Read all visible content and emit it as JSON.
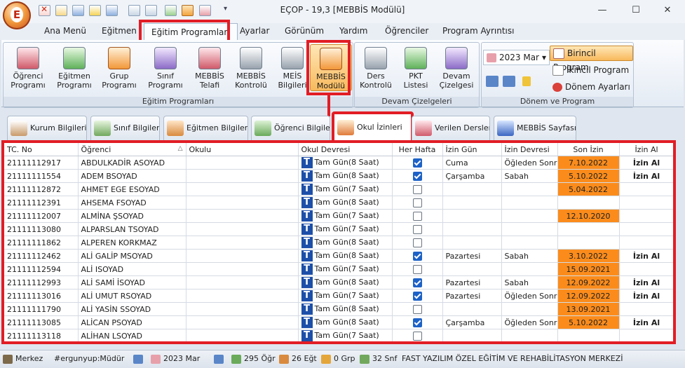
{
  "window": {
    "title": "EÇOP - 19,3 [MEBBİS Modülü]"
  },
  "menu": [
    "Ana Menü",
    "Eğitmen",
    "Eğitim Programları",
    "Ayarlar",
    "Görünüm",
    "Yardım",
    "Öğrenciler",
    "Program Ayrıntısı"
  ],
  "ribbon": {
    "groups": {
      "egitim": "Eğitim Programları",
      "devam": "Devam Çizelgeleri",
      "donem": "Dönem ve Program"
    },
    "buttons": [
      "Öğrenci Programı",
      "Eğitmen Programı",
      "Grup Programı",
      "Sınıf Programı",
      "MEBBİS Telafi",
      "MEBBİS Kontrolü",
      "MEİS Bilgileri",
      "MEBBİS Modülü",
      "Ders Kontrolü",
      "PKT Listesi",
      "Devam Çizelgesi"
    ],
    "month_select": "2023 Mar",
    "side_buttons": [
      "Birincil Program",
      "İkincil Program",
      "Dönem Ayarları"
    ]
  },
  "tabs": [
    "Kurum Bilgileri",
    "Sınıf Bilgileri",
    "Eğitmen Bilgileri",
    "Öğrenci Bilgileri",
    "Okul İzinleri",
    "Verilen Dersler",
    "MEBBİS Sayfası"
  ],
  "grid": {
    "columns": [
      "TC. No",
      "Öğrenci",
      "Okulu",
      "Okul Devresi",
      "Her Hafta",
      "İzin Gün",
      "İzin Devresi",
      "Son İzin",
      "İzin Al"
    ],
    "rows": [
      {
        "tc": "21111112917",
        "name": "ABDULKADİR ASOYAD",
        "okul": "",
        "devre": "Tam Gün(8 Saat)",
        "her_hafta": true,
        "gun": "Cuma",
        "izin_devresi": "Öğleden Sonra",
        "son_izin": "7.10.2022",
        "izin_al": "İzin Al"
      },
      {
        "tc": "21111111554",
        "name": "ADEM BSOYAD",
        "okul": "",
        "devre": "Tam Gün(8 Saat)",
        "her_hafta": true,
        "gun": "Çarşamba",
        "izin_devresi": "Sabah",
        "son_izin": "5.10.2022",
        "izin_al": "İzin Al"
      },
      {
        "tc": "21111112872",
        "name": "AHMET EGE ESOYAD",
        "okul": "",
        "devre": "Tam Gün(7 Saat)",
        "her_hafta": false,
        "gun": "",
        "izin_devresi": "",
        "son_izin": "5.04.2022",
        "izin_al": ""
      },
      {
        "tc": "21111112391",
        "name": "AHSEMA FSOYAD",
        "okul": "",
        "devre": "Tam Gün(8 Saat)",
        "her_hafta": false,
        "gun": "",
        "izin_devresi": "",
        "son_izin": "",
        "izin_al": ""
      },
      {
        "tc": "21111112007",
        "name": "ALMİNA ŞSOYAD",
        "okul": "",
        "devre": "Tam Gün(7 Saat)",
        "her_hafta": false,
        "gun": "",
        "izin_devresi": "",
        "son_izin": "12.10.2020",
        "izin_al": ""
      },
      {
        "tc": "21111113080",
        "name": "ALPARSLAN TSOYAD",
        "okul": "",
        "devre": "Tam Gün(7 Saat)",
        "her_hafta": false,
        "gun": "",
        "izin_devresi": "",
        "son_izin": "",
        "izin_al": ""
      },
      {
        "tc": "21111111862",
        "name": "ALPEREN KORKMAZ",
        "okul": "",
        "devre": "Tam Gün(8 Saat)",
        "her_hafta": false,
        "gun": "",
        "izin_devresi": "",
        "son_izin": "",
        "izin_al": ""
      },
      {
        "tc": "21111112462",
        "name": "ALİ GALİP MSOYAD",
        "okul": "",
        "devre": "Tam Gün(8 Saat)",
        "her_hafta": true,
        "gun": "Pazartesi",
        "izin_devresi": "Sabah",
        "son_izin": "3.10.2022",
        "izin_al": "İzin Al"
      },
      {
        "tc": "21111112594",
        "name": "ALİ ISOYAD",
        "okul": "",
        "devre": "Tam Gün(7 Saat)",
        "her_hafta": false,
        "gun": "",
        "izin_devresi": "",
        "son_izin": "15.09.2021",
        "izin_al": ""
      },
      {
        "tc": "21111112993",
        "name": "ALİ SAMİ İSOYAD",
        "okul": "",
        "devre": "Tam Gün(8 Saat)",
        "her_hafta": true,
        "gun": "Pazartesi",
        "izin_devresi": "Sabah",
        "son_izin": "12.09.2022",
        "izin_al": "İzin Al"
      },
      {
        "tc": "21111113016",
        "name": "ALİ UMUT RSOYAD",
        "okul": "",
        "devre": "Tam Gün(7 Saat)",
        "her_hafta": true,
        "gun": "Pazartesi",
        "izin_devresi": "Öğleden Sonra",
        "son_izin": "12.09.2022",
        "izin_al": "İzin Al"
      },
      {
        "tc": "21111111790",
        "name": "ALİ YASİN SSOYAD",
        "okul": "",
        "devre": "Tam Gün(8 Saat)",
        "her_hafta": false,
        "gun": "",
        "izin_devresi": "",
        "son_izin": "13.09.2021",
        "izin_al": ""
      },
      {
        "tc": "21111113085",
        "name": "ALİCAN PSOYAD",
        "okul": "",
        "devre": "Tam Gün(8 Saat)",
        "her_hafta": true,
        "gun": "Çarşamba",
        "izin_devresi": "Öğleden Sonra",
        "son_izin": "5.10.2022",
        "izin_al": "İzin Al"
      },
      {
        "tc": "21111113118",
        "name": "ALİHAN LSOYAD",
        "okul": "",
        "devre": "Tam Gün(7 Saat)",
        "her_hafta": false,
        "gun": "",
        "izin_devresi": "",
        "son_izin": "",
        "izin_al": ""
      }
    ]
  },
  "status": {
    "location": "Merkez",
    "user": "#ergunyup:Müdür",
    "month": "2023 Mar",
    "students": "295 Öğr",
    "trainers": "26 Eğt",
    "groups": "0 Grp",
    "classes": "32 Snf",
    "institution": "FAST YAZILIM ÖZEL EĞİTİM VE REHABİLİTASYON MERKEZİ"
  },
  "colors": {
    "highlight_red": "#e21d25",
    "orange": "#fb8c1c",
    "t_badge": "#1d4fa8",
    "check": "#1d62c7"
  }
}
